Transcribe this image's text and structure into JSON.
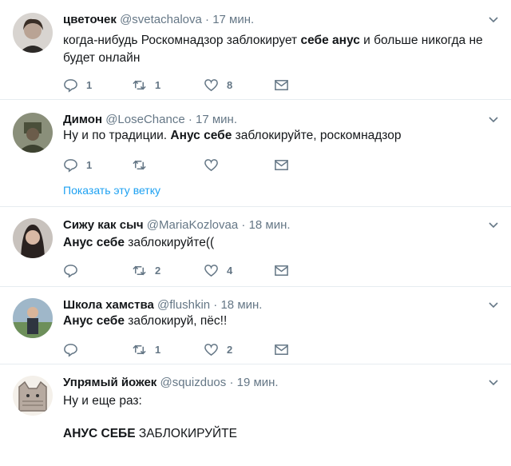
{
  "tweets": [
    {
      "name": "цветочек",
      "handle": "@svetachalova",
      "dot": "·",
      "time": "17 мин.",
      "text": [
        {
          "t": "когда-нибудь Роскомнадзор заблокирует ",
          "b": false
        },
        {
          "t": "себе анус",
          "b": true
        },
        {
          "t": " и больше никогда не будет онлайн",
          "b": false
        }
      ],
      "reply_count": "1",
      "retweet_count": "1",
      "like_count": "8"
    },
    {
      "name": "Димон",
      "handle": "@LoseChance",
      "dot": "·",
      "time": "17 мин.",
      "text": [
        {
          "t": "Ну и по традиции. ",
          "b": false
        },
        {
          "t": "Анус себе",
          "b": true
        },
        {
          "t": " заблокируйте, роскомнадзор",
          "b": false
        }
      ],
      "reply_count": "1",
      "retweet_count": "",
      "like_count": "",
      "thread_link": "Показать эту ветку"
    },
    {
      "name": "Сижу как сыч",
      "handle": "@MariaKozlovaa",
      "dot": "·",
      "time": "18 мин.",
      "text": [
        {
          "t": "Анус себе",
          "b": true
        },
        {
          "t": " заблокируйте((",
          "b": false
        }
      ],
      "reply_count": "",
      "retweet_count": "2",
      "like_count": "4"
    },
    {
      "name": "Школа хамства",
      "handle": "@flushkin",
      "dot": "·",
      "time": "18 мин.",
      "text": [
        {
          "t": "Анус себе",
          "b": true
        },
        {
          "t": " заблокируй, пёс!!",
          "b": false
        }
      ],
      "reply_count": "",
      "retweet_count": "1",
      "like_count": "2"
    },
    {
      "name": "Упрямый йожек",
      "handle": "@squizduos",
      "dot": "·",
      "time": "19 мин.",
      "text_line1": "Ну и еще раз:",
      "text_line2": [
        {
          "t": "АНУС СЕБЕ",
          "b": true
        },
        {
          "t": " ЗАБЛОКИРУЙТЕ",
          "b": false
        }
      ]
    }
  ],
  "icons": {
    "reply": "reply-icon",
    "retweet": "retweet-icon",
    "like": "heart-icon",
    "dm": "envelope-icon",
    "caret": "chevron-down-icon"
  },
  "colors": {
    "text": "#14171a",
    "secondary": "#657786",
    "link": "#1da1f2",
    "border": "#e6ecf0"
  }
}
